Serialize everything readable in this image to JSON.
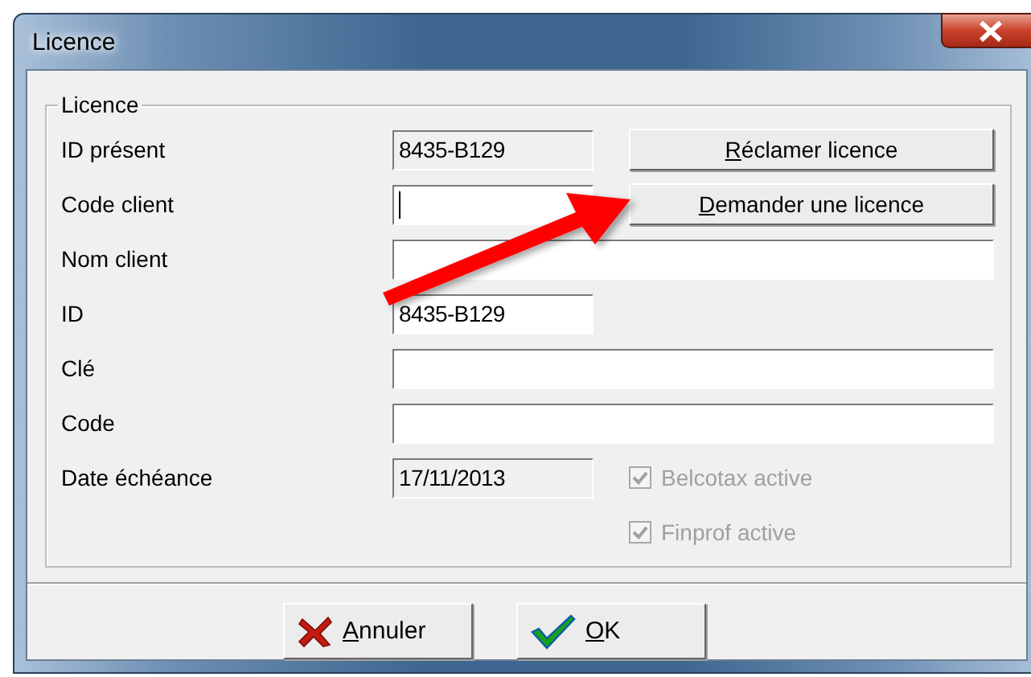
{
  "window": {
    "title": "Licence"
  },
  "group": {
    "title": "Licence"
  },
  "rows": [
    {
      "label": "ID présent",
      "field": {
        "value": "8435-B129",
        "kind": "readonly",
        "focused": false
      },
      "button": "Réclamer licence"
    },
    {
      "label": "Code client",
      "field": {
        "kind": "edit",
        "focused": true
      },
      "button": "Demander une licence"
    },
    {
      "label": "Nom client",
      "field": {
        "kind": "wide",
        "focused": false
      }
    },
    {
      "label": "ID",
      "field": {
        "value": "8435-B129",
        "kind": "edit",
        "focused": false
      }
    },
    {
      "label": "Clé",
      "field": {
        "kind": "wide",
        "focused": false
      }
    },
    {
      "label": "Code",
      "field": {
        "kind": "wide",
        "focused": false
      }
    },
    {
      "label": "Date échéance",
      "field": {
        "value": "17/11/2013",
        "kind": "readonly",
        "focused": false
      },
      "checkbox": {
        "label": "Belcotax active",
        "checked": true,
        "disabled": true
      }
    },
    {
      "checkbox": {
        "label": "Finprof active",
        "checked": true,
        "disabled": true
      }
    }
  ],
  "buttons": [
    {
      "label": "Annuler",
      "kind": "cancel"
    },
    {
      "label": "OK",
      "kind": "ok"
    }
  ]
}
